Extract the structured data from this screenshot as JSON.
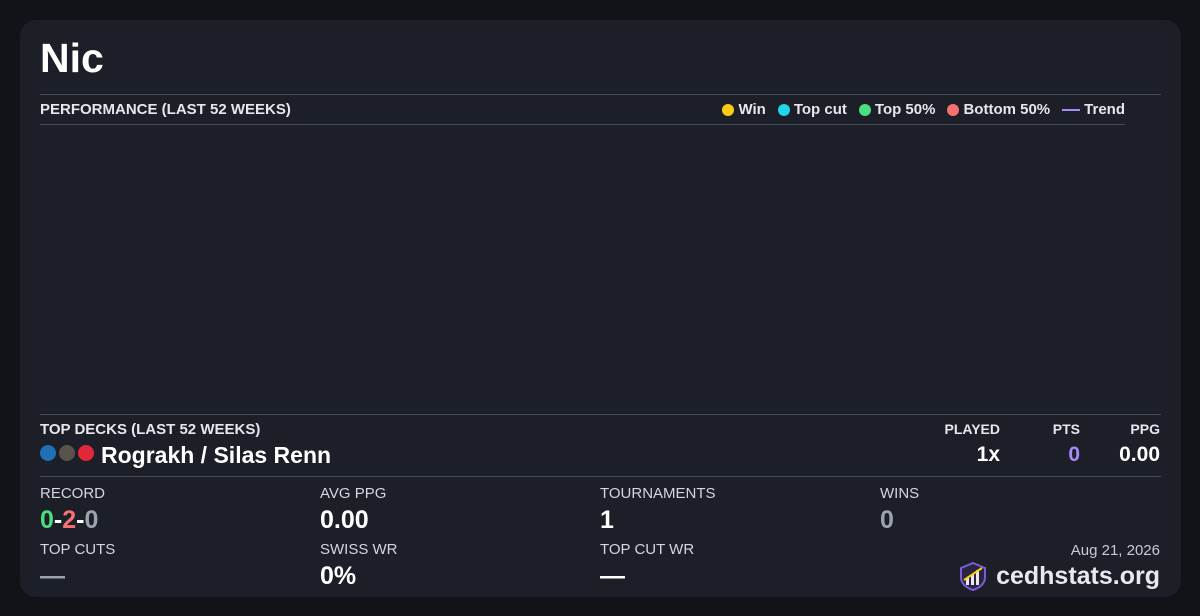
{
  "player": {
    "name": "Nic"
  },
  "performance": {
    "label": "PERFORMANCE (LAST 52 WEEKS)",
    "legend": [
      {
        "label": "Win",
        "color": "#facc15",
        "kind": "dot"
      },
      {
        "label": "Top cut",
        "color": "#22d3ee",
        "kind": "dot"
      },
      {
        "label": "Top 50%",
        "color": "#4ade80",
        "kind": "dot"
      },
      {
        "label": "Bottom 50%",
        "color": "#f87171",
        "kind": "dot"
      },
      {
        "label": "Trend",
        "color": "#a78bfa",
        "kind": "line"
      }
    ]
  },
  "top_decks": {
    "label": "TOP DECKS (LAST 52 WEEKS)",
    "columns": {
      "played": "PLAYED",
      "pts": "PTS",
      "ppg": "PPG"
    },
    "deck": {
      "name": "Rograkh / Silas Renn",
      "colors": [
        "#1f6fb5",
        "#5a534c",
        "#e0283a"
      ],
      "played": "1x",
      "pts": "0",
      "ppg": "0.00"
    }
  },
  "stats": {
    "record": {
      "label": "RECORD",
      "wins": "0",
      "losses": "2",
      "draws": "0",
      "sep": "-"
    },
    "avg_ppg": {
      "label": "AVG PPG",
      "value": "0.00"
    },
    "tournaments": {
      "label": "TOURNAMENTS",
      "value": "1"
    },
    "wins": {
      "label": "WINS",
      "value": "0"
    },
    "top_cuts": {
      "label": "TOP CUTS",
      "value": "—"
    },
    "swiss_wr": {
      "label": "SWISS WR",
      "value": "0%"
    },
    "top_cut_wr": {
      "label": "TOP CUT WR",
      "value": "—"
    }
  },
  "footer": {
    "date": "Aug 21, 2026",
    "brand": "cedhstats.org",
    "brand_icon": "bar-chart-shield-icon"
  },
  "colors": {
    "win": "#4ade80",
    "loss": "#f87171",
    "pts_accent": "#a78bfa"
  }
}
